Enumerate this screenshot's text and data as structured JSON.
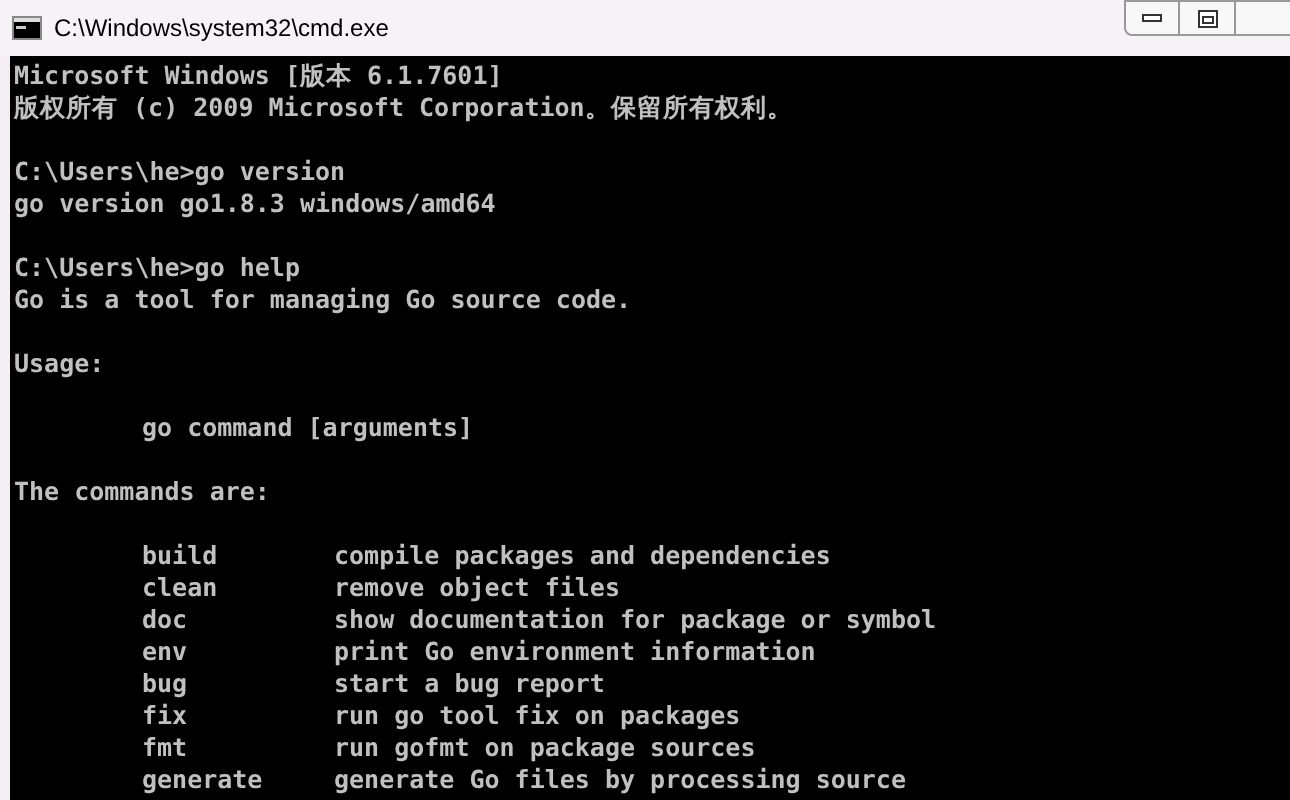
{
  "window": {
    "title": "C:\\Windows\\system32\\cmd.exe"
  },
  "console": {
    "lines": [
      {
        "kind": "line",
        "text": "Microsoft Windows [版本 6.1.7601]"
      },
      {
        "kind": "line",
        "text": "版权所有 (c) 2009 Microsoft Corporation。保留所有权利。"
      },
      {
        "kind": "gap"
      },
      {
        "kind": "line",
        "text": "C:\\Users\\he>go version"
      },
      {
        "kind": "line",
        "text": "go version go1.8.3 windows/amd64"
      },
      {
        "kind": "gap"
      },
      {
        "kind": "line",
        "text": "C:\\Users\\he>go help"
      },
      {
        "kind": "line",
        "text": "Go is a tool for managing Go source code."
      },
      {
        "kind": "gap"
      },
      {
        "kind": "line",
        "text": "Usage:"
      },
      {
        "kind": "gap"
      },
      {
        "kind": "indented",
        "text": "go command [arguments]"
      },
      {
        "kind": "gap"
      },
      {
        "kind": "line",
        "text": "The commands are:"
      },
      {
        "kind": "gap"
      }
    ],
    "commands": [
      {
        "name": "build",
        "description": "compile packages and dependencies"
      },
      {
        "name": "clean",
        "description": "remove object files"
      },
      {
        "name": "doc",
        "description": "show documentation for package or symbol"
      },
      {
        "name": "env",
        "description": "print Go environment information"
      },
      {
        "name": "bug",
        "description": "start a bug report"
      },
      {
        "name": "fix",
        "description": "run go tool fix on packages"
      },
      {
        "name": "fmt",
        "description": "run gofmt on package sources"
      },
      {
        "name": "generate",
        "description": "generate Go files by processing source"
      }
    ]
  }
}
